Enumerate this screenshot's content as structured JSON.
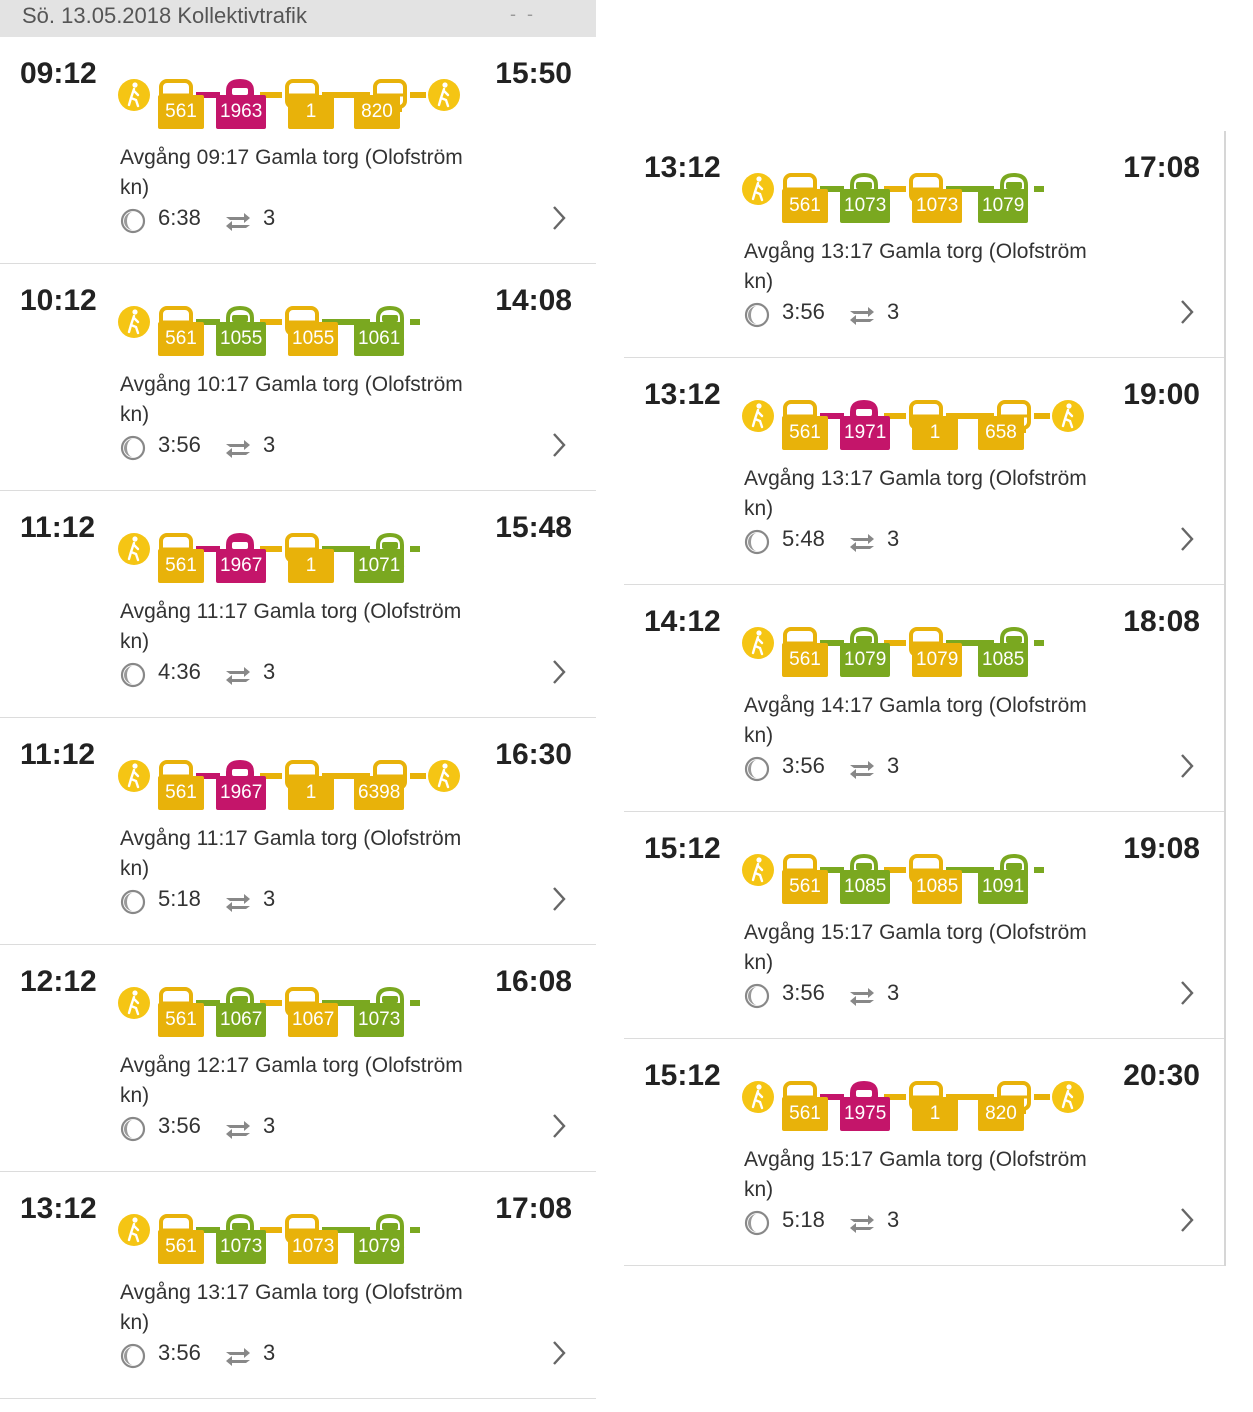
{
  "header": {
    "title": "Sö. 13.05.2018 Kollektivtrafik",
    "marker": "- -"
  },
  "colors": {
    "bus": "#e8b20a",
    "train": "#7aa820",
    "pendel": "#c4156a",
    "walk": "#f5c514",
    "gray": "#aaaaaa"
  },
  "icons": {
    "walk": "walk-icon",
    "bus": "bus-icon",
    "train": "train-icon",
    "pendel": "pendeltag-icon",
    "duration": "clock-icon",
    "changes": "transfer-icon",
    "open": "chevron-right-icon"
  },
  "left_trips": [
    {
      "dep": "09:12",
      "arr": "15:50",
      "desc": "Avgång 09:17 Gamla torg (Olofström kn)",
      "duration": "6:38",
      "changes": "3",
      "legs": [
        "walk",
        "bus",
        "pendel",
        "bus",
        "bus",
        "walk"
      ],
      "lines": [
        {
          "t": "bus",
          "n": "561"
        },
        {
          "t": "pendel",
          "n": "1963"
        },
        {
          "t": "bus",
          "n": "1"
        },
        {
          "t": "bus",
          "n": "820"
        }
      ]
    },
    {
      "dep": "10:12",
      "arr": "14:08",
      "desc": "Avgång 10:17 Gamla torg (Olofström kn)",
      "duration": "3:56",
      "changes": "3",
      "legs": [
        "walk",
        "bus",
        "train",
        "bus",
        "train"
      ],
      "lines": [
        {
          "t": "bus",
          "n": "561"
        },
        {
          "t": "train",
          "n": "1055"
        },
        {
          "t": "bus",
          "n": "1055"
        },
        {
          "t": "train",
          "n": "1061"
        }
      ]
    },
    {
      "dep": "11:12",
      "arr": "15:48",
      "desc": "Avgång 11:17 Gamla torg (Olofström kn)",
      "duration": "4:36",
      "changes": "3",
      "legs": [
        "walk",
        "bus",
        "pendel",
        "bus",
        "train"
      ],
      "lines": [
        {
          "t": "bus",
          "n": "561"
        },
        {
          "t": "pendel",
          "n": "1967"
        },
        {
          "t": "bus",
          "n": "1"
        },
        {
          "t": "train",
          "n": "1071"
        }
      ]
    },
    {
      "dep": "11:12",
      "arr": "16:30",
      "desc": "Avgång 11:17 Gamla torg (Olofström kn)",
      "duration": "5:18",
      "changes": "3",
      "legs": [
        "walk",
        "bus",
        "pendel",
        "bus",
        "bus",
        "walk"
      ],
      "lines": [
        {
          "t": "bus",
          "n": "561"
        },
        {
          "t": "pendel",
          "n": "1967"
        },
        {
          "t": "bus",
          "n": "1"
        },
        {
          "t": "bus",
          "n": "6398"
        }
      ]
    },
    {
      "dep": "12:12",
      "arr": "16:08",
      "desc": "Avgång 12:17 Gamla torg (Olofström kn)",
      "duration": "3:56",
      "changes": "3",
      "legs": [
        "walk",
        "bus",
        "train",
        "bus",
        "train"
      ],
      "lines": [
        {
          "t": "bus",
          "n": "561"
        },
        {
          "t": "train",
          "n": "1067"
        },
        {
          "t": "bus",
          "n": "1067"
        },
        {
          "t": "train",
          "n": "1073"
        }
      ]
    },
    {
      "dep": "13:12",
      "arr": "17:08",
      "desc": "Avgång 13:17 Gamla torg (Olofström kn)",
      "duration": "3:56",
      "changes": "3",
      "legs": [
        "walk",
        "bus",
        "train",
        "bus",
        "train"
      ],
      "lines": [
        {
          "t": "bus",
          "n": "561"
        },
        {
          "t": "train",
          "n": "1073"
        },
        {
          "t": "bus",
          "n": "1073"
        },
        {
          "t": "train",
          "n": "1079"
        }
      ]
    }
  ],
  "right_trips": [
    {
      "dep": "13:12",
      "arr": "17:08",
      "desc": "Avgång 13:17 Gamla torg (Olofström kn)",
      "duration": "3:56",
      "changes": "3",
      "legs": [
        "walk",
        "bus",
        "train",
        "bus",
        "train"
      ],
      "lines": [
        {
          "t": "bus",
          "n": "561"
        },
        {
          "t": "train",
          "n": "1073"
        },
        {
          "t": "bus",
          "n": "1073"
        },
        {
          "t": "train",
          "n": "1079"
        }
      ]
    },
    {
      "dep": "13:12",
      "arr": "19:00",
      "desc": "Avgång 13:17 Gamla torg (Olofström kn)",
      "duration": "5:48",
      "changes": "3",
      "legs": [
        "walk",
        "bus",
        "pendel",
        "bus",
        "bus",
        "walk"
      ],
      "lines": [
        {
          "t": "bus",
          "n": "561"
        },
        {
          "t": "pendel",
          "n": "1971"
        },
        {
          "t": "bus",
          "n": "1"
        },
        {
          "t": "bus",
          "n": "658"
        }
      ]
    },
    {
      "dep": "14:12",
      "arr": "18:08",
      "desc": "Avgång 14:17 Gamla torg (Olofström kn)",
      "duration": "3:56",
      "changes": "3",
      "legs": [
        "walk",
        "bus",
        "train",
        "bus",
        "train"
      ],
      "lines": [
        {
          "t": "bus",
          "n": "561"
        },
        {
          "t": "train",
          "n": "1079"
        },
        {
          "t": "bus",
          "n": "1079"
        },
        {
          "t": "train",
          "n": "1085"
        }
      ]
    },
    {
      "dep": "15:12",
      "arr": "19:08",
      "desc": "Avgång 15:17 Gamla torg (Olofström kn)",
      "duration": "3:56",
      "changes": "3",
      "legs": [
        "walk",
        "bus",
        "train",
        "bus",
        "train"
      ],
      "lines": [
        {
          "t": "bus",
          "n": "561"
        },
        {
          "t": "train",
          "n": "1085"
        },
        {
          "t": "bus",
          "n": "1085"
        },
        {
          "t": "train",
          "n": "1091"
        }
      ]
    },
    {
      "dep": "15:12",
      "arr": "20:30",
      "desc": "Avgång 15:17 Gamla torg (Olofström kn)",
      "duration": "5:18",
      "changes": "3",
      "legs": [
        "walk",
        "bus",
        "pendel",
        "bus",
        "bus",
        "walk"
      ],
      "lines": [
        {
          "t": "bus",
          "n": "561"
        },
        {
          "t": "pendel",
          "n": "1975"
        },
        {
          "t": "bus",
          "n": "1"
        },
        {
          "t": "bus",
          "n": "820"
        }
      ]
    }
  ]
}
